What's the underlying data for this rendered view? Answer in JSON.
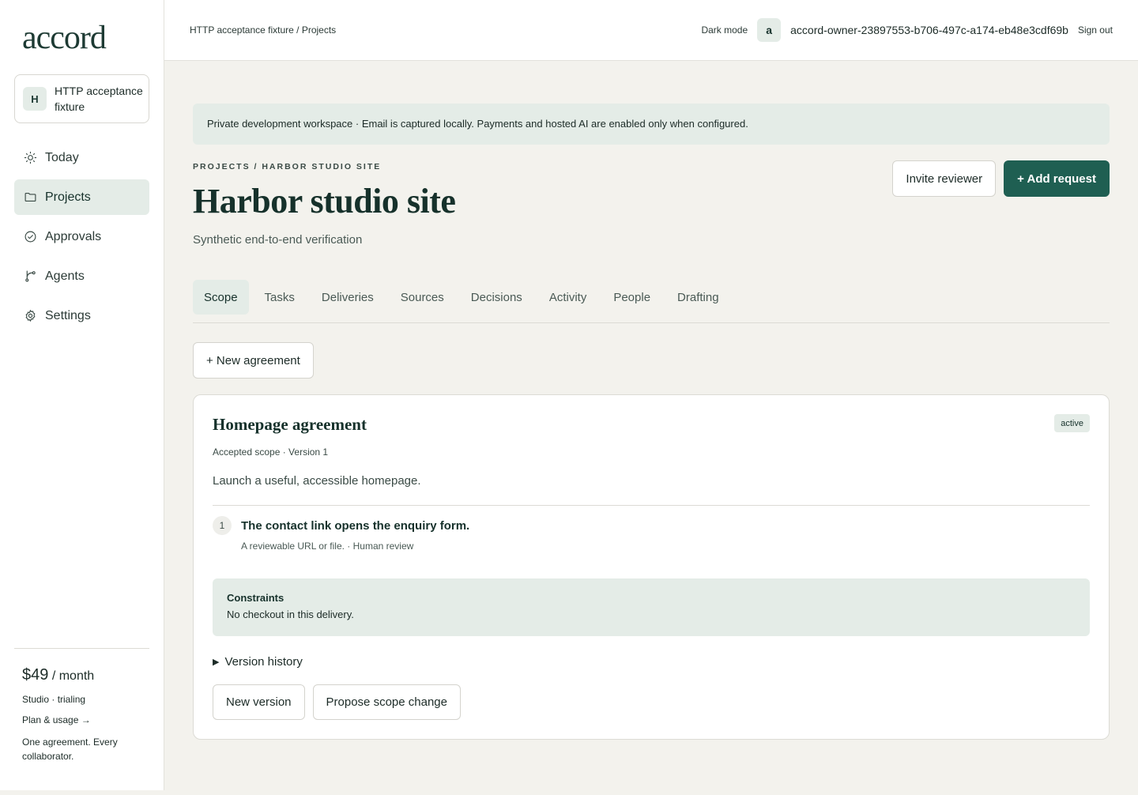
{
  "app": {
    "logo": "accord"
  },
  "workspace": {
    "initial": "H",
    "name": "HTTP acceptance fixture"
  },
  "sidebar": {
    "items": [
      {
        "label": "Today",
        "icon": "sun-icon"
      },
      {
        "label": "Projects",
        "icon": "folder-icon",
        "active": true
      },
      {
        "label": "Approvals",
        "icon": "check-circle-icon"
      },
      {
        "label": "Agents",
        "icon": "branch-icon"
      },
      {
        "label": "Settings",
        "icon": "gear-icon"
      }
    ],
    "footer": {
      "price": "$49",
      "period": " / month",
      "plan": "Studio · trialing",
      "plan_link": "Plan & usage →",
      "tagline": "One agreement. Every collaborator."
    }
  },
  "topbar": {
    "breadcrumb": "HTTP acceptance fixture / Projects",
    "dark_mode": "Dark mode",
    "avatar": "a",
    "user": "accord-owner-23897553-b706-497c-a174-eb48e3cdf69b",
    "sign_out": "Sign out"
  },
  "banner": "Private development workspace · Email is captured locally. Payments and hosted AI are enabled only when configured.",
  "page": {
    "eyebrow": "PROJECTS / HARBOR STUDIO SITE",
    "title": "Harbor studio site",
    "subtitle": "Synthetic end-to-end verification",
    "invite": "Invite reviewer",
    "add_request": "+ Add request"
  },
  "tabs": [
    "Scope",
    "Tasks",
    "Deliveries",
    "Sources",
    "Decisions",
    "Activity",
    "People",
    "Drafting"
  ],
  "new_agreement": "+ New agreement",
  "agreement": {
    "title": "Homepage agreement",
    "status": "active",
    "meta": "Accepted scope · Version 1",
    "description": "Launch a useful, accessible homepage.",
    "item_number": "1",
    "item_title": "The contact link opens the enquiry form.",
    "item_sub": "A reviewable URL or file. · Human review",
    "constraints_title": "Constraints",
    "constraints_text": "No checkout in this delivery.",
    "history": "Version history",
    "new_version": "New version",
    "propose": "Propose scope change"
  },
  "colors": {
    "accent": "#1f5f52",
    "tint": "#e4ece7",
    "background": "#f3f2ed"
  }
}
